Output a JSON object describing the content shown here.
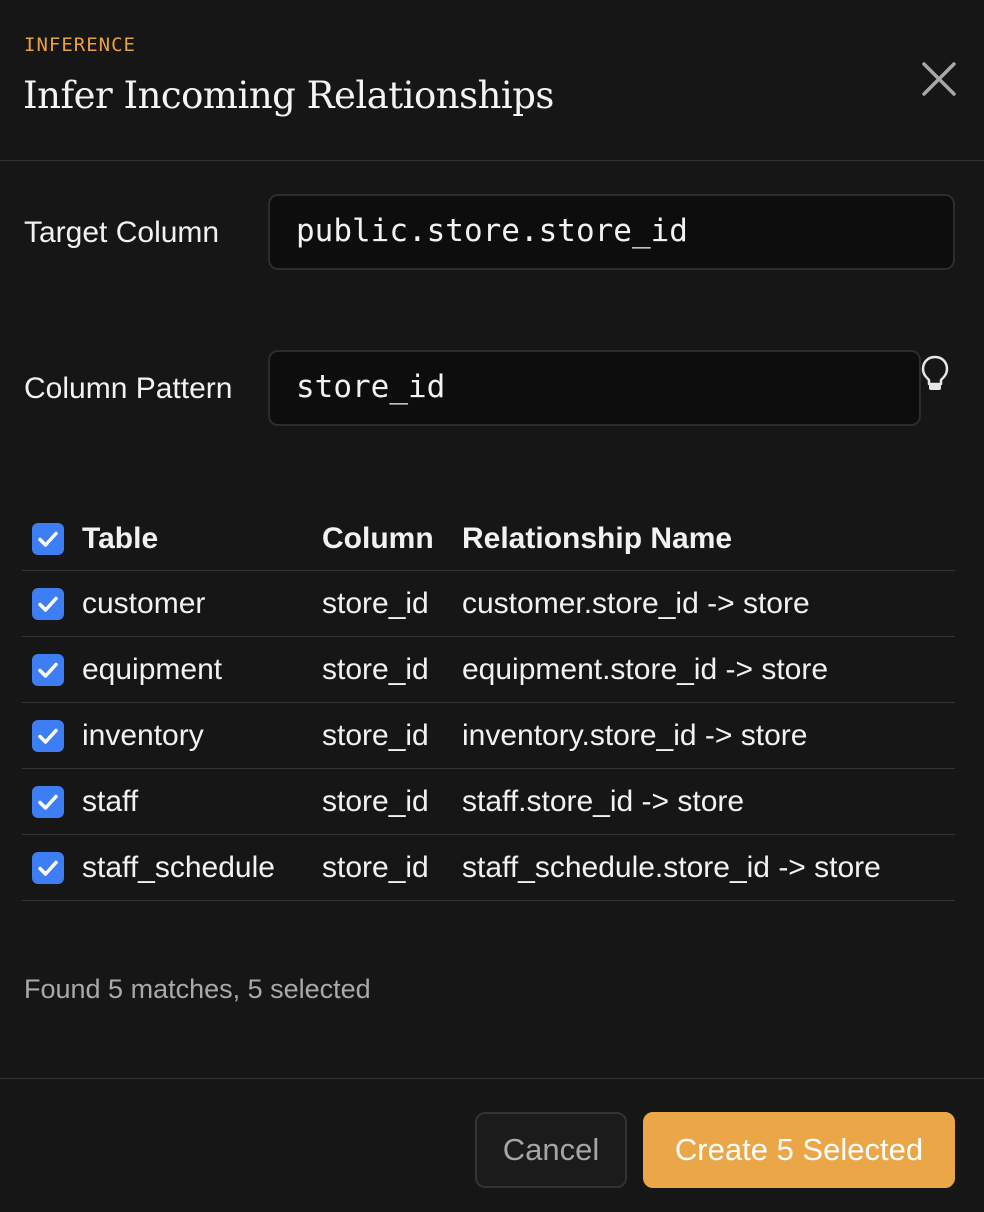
{
  "dialog": {
    "eyebrow": "INFERENCE",
    "title": "Infer Incoming Relationships",
    "close_icon": "close-icon"
  },
  "fields": {
    "target_column": {
      "label": "Target Column",
      "value": "public.store.store_id"
    },
    "column_pattern": {
      "label": "Column Pattern",
      "value": "store_id",
      "hint_icon": "lightbulb-icon"
    }
  },
  "table": {
    "headers": {
      "table": "Table",
      "column": "Column",
      "relationship": "Relationship Name"
    },
    "select_all_checked": true,
    "rows": [
      {
        "checked": true,
        "table": "customer",
        "column": "store_id",
        "relationship": "customer.store_id -> store"
      },
      {
        "checked": true,
        "table": "equipment",
        "column": "store_id",
        "relationship": "equipment.store_id -> store"
      },
      {
        "checked": true,
        "table": "inventory",
        "column": "store_id",
        "relationship": "inventory.store_id -> store"
      },
      {
        "checked": true,
        "table": "staff",
        "column": "store_id",
        "relationship": "staff.store_id -> store"
      },
      {
        "checked": true,
        "table": "staff_schedule",
        "column": "store_id",
        "relationship": "staff_schedule.store_id -> store"
      }
    ]
  },
  "summary": "Found 5 matches, 5 selected",
  "footer": {
    "cancel_label": "Cancel",
    "create_label": "Create 5 Selected"
  },
  "colors": {
    "background": "#161616",
    "accent": "#eba647",
    "eyebrow": "#e8a23e",
    "checkbox": "#3d7ef5"
  }
}
